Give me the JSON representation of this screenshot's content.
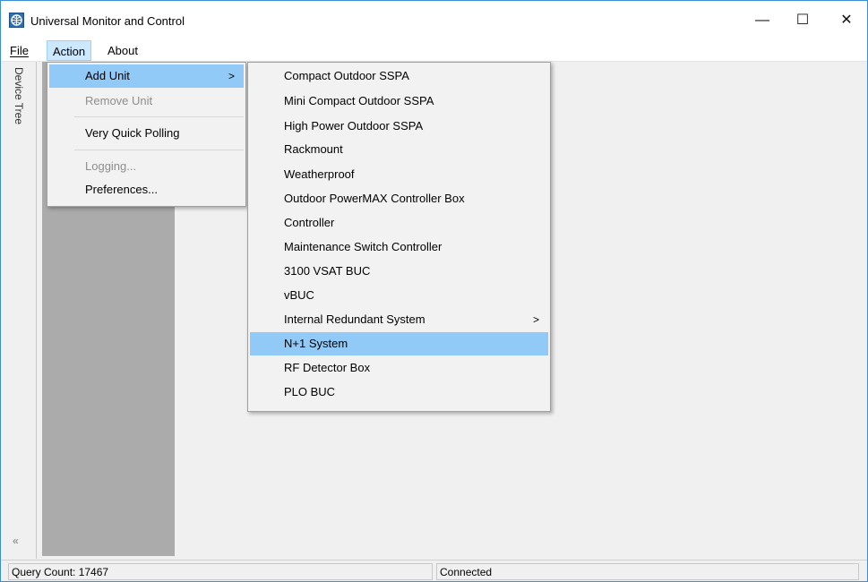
{
  "window": {
    "title": "Universal Monitor and Control"
  },
  "titlebar_buttons": {
    "minimize": "—",
    "maximize": "☐",
    "close": "✕"
  },
  "menubar": {
    "file": "File",
    "action": "Action",
    "about": "About"
  },
  "sidebar": {
    "label": "Device Tree",
    "collapse": "«"
  },
  "action_menu": {
    "items": [
      {
        "label": "Add Unit",
        "arrow": ">",
        "state": "highlighted"
      },
      {
        "label": "Remove Unit",
        "state": "disabled"
      },
      {
        "label": "Very Quick Polling",
        "state": "normal"
      },
      {
        "label": "Logging...",
        "state": "disabled"
      },
      {
        "label": "Preferences...",
        "state": "normal"
      }
    ]
  },
  "add_unit_menu": {
    "items": [
      {
        "label": "Compact Outdoor SSPA"
      },
      {
        "label": "Mini Compact Outdoor SSPA"
      },
      {
        "label": "High Power Outdoor SSPA"
      },
      {
        "label": "Rackmount"
      },
      {
        "label": "Weatherproof"
      },
      {
        "label": "Outdoor PowerMAX Controller Box"
      },
      {
        "label": "Controller"
      },
      {
        "label": "Maintenance Switch Controller"
      },
      {
        "label": "3100 VSAT BUC"
      },
      {
        "label": "vBUC"
      },
      {
        "label": "Internal Redundant System",
        "arrow": ">"
      },
      {
        "label": "N+1 System",
        "state": "highlighted"
      },
      {
        "label": "RF Detector Box"
      },
      {
        "label": "PLO BUC"
      }
    ]
  },
  "statusbar": {
    "query_count": "Query Count: 17467",
    "connection": "Connected"
  },
  "colors": {
    "highlight": "#91c9f7",
    "panel_gray": "#ababab",
    "menu_bg": "#f2f2f2"
  }
}
